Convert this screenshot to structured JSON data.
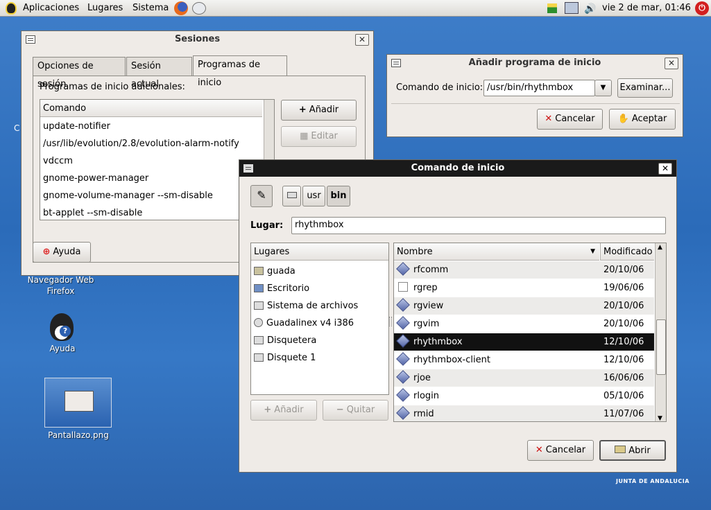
{
  "panel": {
    "menus": [
      "Aplicaciones",
      "Lugares",
      "Sistema"
    ],
    "clock": "vie  2 de mar, 01:46"
  },
  "desktop": {
    "icons": [
      {
        "label": "Navegador Web\nFirefox"
      },
      {
        "label": "Ayuda"
      },
      {
        "label": "Pantallazo.png"
      }
    ],
    "watermark": "JUNTA DE ANDALUCIA"
  },
  "sesiones": {
    "title": "Sesiones",
    "tabs": [
      "Opciones de sesión",
      "Sesión actual",
      "Programas de inicio"
    ],
    "section_label": "Programas de inicio adicionales:",
    "column_header": "Comando",
    "commands": [
      "update-notifier",
      "/usr/lib/evolution/2.8/evolution-alarm-notify",
      "vdccm",
      "gnome-power-manager",
      "gnome-volume-manager --sm-disable",
      "bt-applet --sm-disable"
    ],
    "add_label": "Añadir",
    "edit_label": "Editar",
    "help_label": "Ayuda"
  },
  "add_program": {
    "title": "Añadir programa de inicio",
    "command_label": "Comando de inicio:",
    "command_value": "/usr/bin/rhythmbox",
    "browse_label": "Examinar...",
    "cancel_label": "Cancelar",
    "accept_label": "Aceptar"
  },
  "chooser": {
    "title": "Comando de inicio",
    "path_buttons": [
      "usr",
      "bin"
    ],
    "location_label": "Lugar:",
    "location_value": "rhythmbox",
    "places_header": "Lugares",
    "places": [
      "guada",
      "Escritorio",
      "Sistema de archivos",
      "Guadalinex v4 i386",
      "Disquetera",
      "Disquete 1"
    ],
    "add_label": "Añadir",
    "remove_label": "Quitar",
    "name_header": "Nombre",
    "modified_header": "Modificado",
    "files": [
      {
        "name": "rfcomm",
        "date": "20/10/06"
      },
      {
        "name": "rgrep",
        "date": "19/06/06"
      },
      {
        "name": "rgview",
        "date": "20/10/06"
      },
      {
        "name": "rgvim",
        "date": "20/10/06"
      },
      {
        "name": "rhythmbox",
        "date": "12/10/06",
        "selected": true
      },
      {
        "name": "rhythmbox-client",
        "date": "12/10/06"
      },
      {
        "name": "rjoe",
        "date": "16/06/06"
      },
      {
        "name": "rlogin",
        "date": "05/10/06"
      },
      {
        "name": "rmid",
        "date": "11/07/06"
      }
    ],
    "cancel_label": "Cancelar",
    "open_label": "Abrir"
  }
}
